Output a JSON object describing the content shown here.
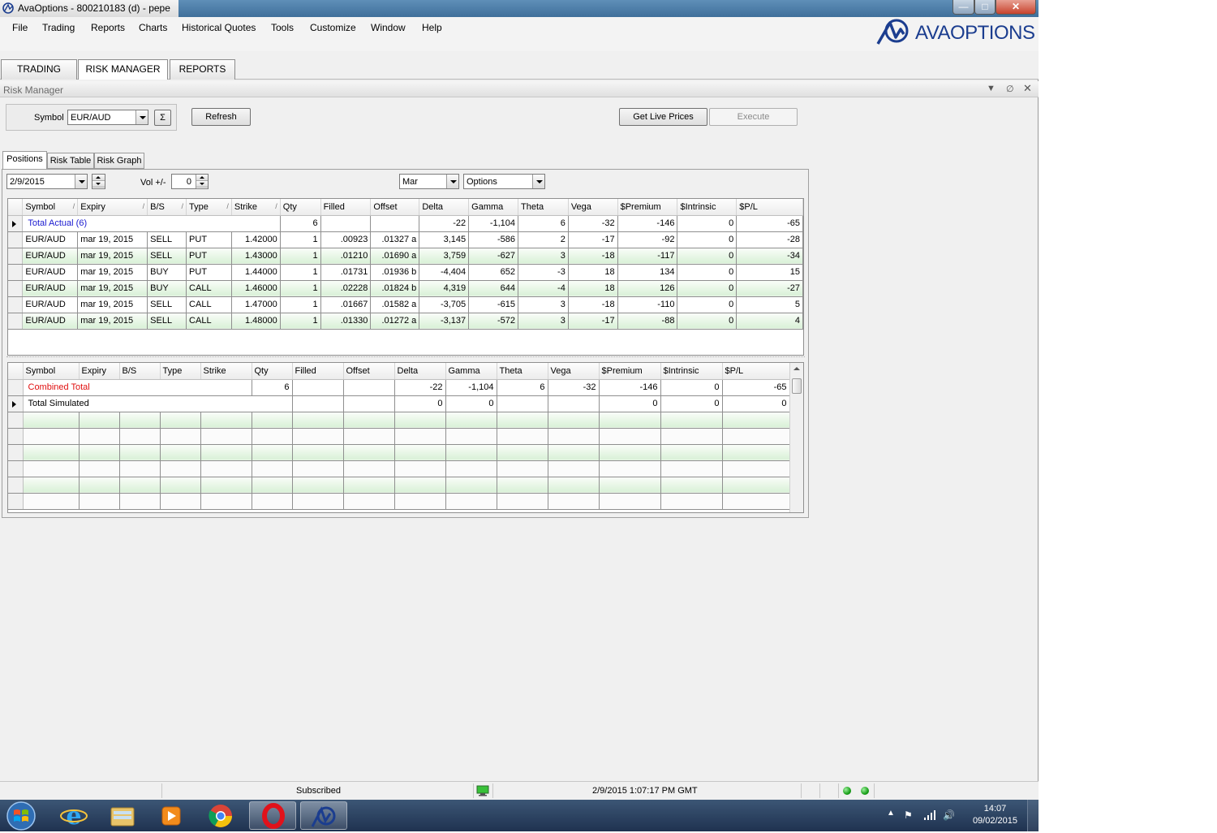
{
  "window": {
    "title": "AvaOptions - 800210183 (d) - pepe"
  },
  "menu": {
    "items": [
      "File",
      "Trading",
      "Reports",
      "Charts",
      "Historical Quotes",
      "Tools",
      "Customize",
      "Window",
      "Help"
    ]
  },
  "logo": {
    "text": "AVAOPTIONS"
  },
  "main_tabs": [
    "TRADING",
    "RISK MANAGER",
    "REPORTS"
  ],
  "panel": {
    "title": "Risk Manager"
  },
  "toolbar": {
    "symbol_label": "Symbol",
    "symbol_value": "EUR/AUD",
    "sigma_label": "Σ",
    "refresh_label": "Refresh",
    "get_live_prices_label": "Get Live Prices",
    "execute_label": "Execute"
  },
  "sub_tabs": [
    "Positions",
    "Risk Table",
    "Risk Graph"
  ],
  "filters": {
    "date_value": "2/9/2015",
    "vol_label": "Vol +/-",
    "vol_value": "0",
    "month_value": "Mar",
    "type_value": "Options"
  },
  "positions_grid": {
    "columns": [
      "Symbol",
      "Expiry",
      "B/S",
      "Type",
      "Strike",
      "Qty",
      "Filled",
      "Offset",
      "Delta",
      "Gamma",
      "Theta",
      "Vega",
      "$Premium",
      "$Intrinsic",
      "$P/L"
    ],
    "total_row": {
      "label": "Total Actual (6)",
      "qty": "6",
      "delta": "-22",
      "gamma": "-1,104",
      "theta": "6",
      "vega": "-32",
      "premium": "-146",
      "intrinsic": "0",
      "pl": "-65"
    },
    "rows": [
      [
        "EUR/AUD",
        "mar 19, 2015",
        "SELL",
        "PUT",
        "1.42000",
        "1",
        ".00923",
        ".01327 a",
        "3,145",
        "-586",
        "2",
        "-17",
        "-92",
        "0",
        "-28"
      ],
      [
        "EUR/AUD",
        "mar 19, 2015",
        "SELL",
        "PUT",
        "1.43000",
        "1",
        ".01210",
        ".01690 a",
        "3,759",
        "-627",
        "3",
        "-18",
        "-117",
        "0",
        "-34"
      ],
      [
        "EUR/AUD",
        "mar 19, 2015",
        "BUY",
        "PUT",
        "1.44000",
        "1",
        ".01731",
        ".01936 b",
        "-4,404",
        "652",
        "-3",
        "18",
        "134",
        "0",
        "15"
      ],
      [
        "EUR/AUD",
        "mar 19, 2015",
        "BUY",
        "CALL",
        "1.46000",
        "1",
        ".02228",
        ".01824 b",
        "4,319",
        "644",
        "-4",
        "18",
        "126",
        "0",
        "-27"
      ],
      [
        "EUR/AUD",
        "mar 19, 2015",
        "SELL",
        "CALL",
        "1.47000",
        "1",
        ".01667",
        ".01582 a",
        "-3,705",
        "-615",
        "3",
        "-18",
        "-110",
        "0",
        "5"
      ],
      [
        "EUR/AUD",
        "mar 19, 2015",
        "SELL",
        "CALL",
        "1.48000",
        "1",
        ".01330",
        ".01272 a",
        "-3,137",
        "-572",
        "3",
        "-17",
        "-88",
        "0",
        "4"
      ]
    ]
  },
  "simulated_grid": {
    "columns": [
      "Symbol",
      "Expiry",
      "B/S",
      "Type",
      "Strike",
      "Qty",
      "Filled",
      "Offset",
      "Delta",
      "Gamma",
      "Theta",
      "Vega",
      "$Premium",
      "$Intrinsic",
      "$P/L"
    ],
    "combined_row": {
      "label": "Combined Total",
      "qty": "6",
      "delta": "-22",
      "gamma": "-1,104",
      "theta": "6",
      "vega": "-32",
      "premium": "-146",
      "intrinsic": "0",
      "pl": "-65"
    },
    "simulated_row": {
      "label": "Total Simulated",
      "delta": "0",
      "gamma": "0",
      "premium": "0",
      "intrinsic": "0",
      "pl": "0"
    }
  },
  "status_bar": {
    "connection_status": "Subscribed",
    "datetime": "2/9/2015 1:07:17 PM  GMT"
  },
  "taskbar": {
    "time": "14:07",
    "date": "09/02/2015"
  },
  "colors": {
    "total_actual_text": "#1a1ad0",
    "combined_total_text": "#e01010",
    "row_green": "#d8f0d6",
    "logo_blue": "#1b3d8f"
  }
}
